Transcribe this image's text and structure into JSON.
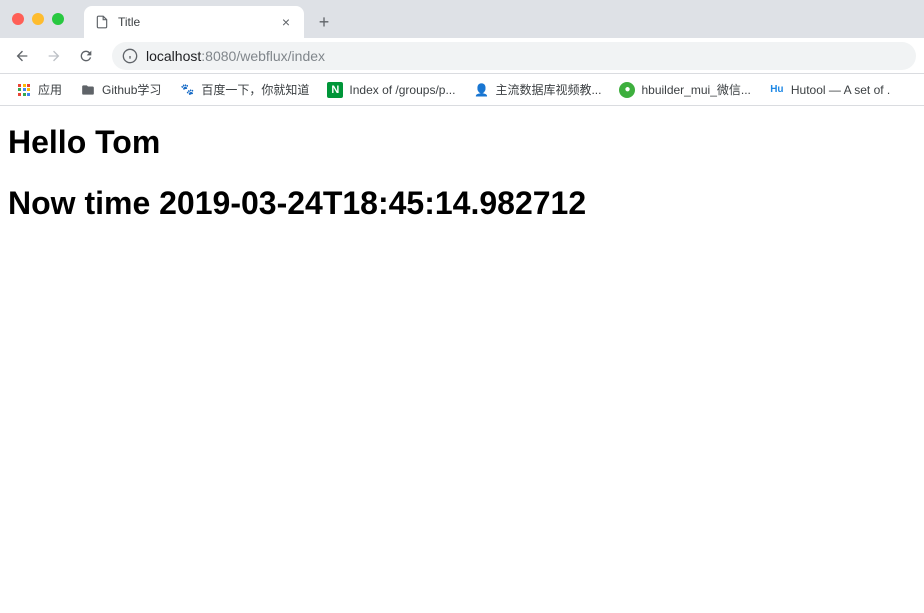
{
  "tab": {
    "title": "Title"
  },
  "url": {
    "host": "localhost",
    "port": ":8080",
    "path": "/webflux/index"
  },
  "bookmarks": [
    {
      "label": "应用",
      "icon": "apps"
    },
    {
      "label": "Github学习",
      "icon": "folder"
    },
    {
      "label": "百度一下，你就知道",
      "icon": "baidu"
    },
    {
      "label": "Index of /groups/p...",
      "icon": "n"
    },
    {
      "label": "主流数据库视频教...",
      "icon": "db"
    },
    {
      "label": "hbuilder_mui_微信...",
      "icon": "hb"
    },
    {
      "label": "Hutool — A set of .",
      "icon": "hu"
    }
  ],
  "page": {
    "heading1": "Hello Tom",
    "heading2": "Now time 2019-03-24T18:45:14.982712"
  }
}
